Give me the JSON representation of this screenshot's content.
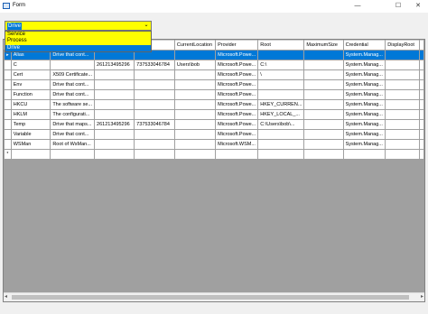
{
  "window": {
    "title": "Form",
    "minimize": "—",
    "maximize": "☐",
    "close": "✕"
  },
  "combo": {
    "value": "Drive",
    "arrow": "⌄"
  },
  "dropdown": {
    "options": [
      {
        "label": "Service",
        "selected": false
      },
      {
        "label": "Process",
        "selected": false
      },
      {
        "label": "Drive",
        "selected": true
      }
    ]
  },
  "grid": {
    "columns": [
      "",
      "",
      "",
      "e",
      "CurrentLocation",
      "Provider",
      "Root",
      "MaximumSize",
      "Credential",
      "DisplayRoot"
    ],
    "rows": [
      [
        "Alias",
        "Drive that cont...",
        "",
        "",
        "",
        "Microsoft.Powe...",
        "",
        "",
        "System.Manag...",
        ""
      ],
      [
        "C",
        "",
        "261213495296",
        "737533046784",
        "Users\\bob",
        "Microsoft.Powe...",
        "C:\\",
        "",
        "System.Manag...",
        ""
      ],
      [
        "Cert",
        "X509 Certificate...",
        "",
        "",
        "",
        "Microsoft.Powe...",
        "\\",
        "",
        "System.Manag...",
        ""
      ],
      [
        "Env",
        "Drive that cont...",
        "",
        "",
        "",
        "Microsoft.Powe...",
        "",
        "",
        "System.Manag...",
        ""
      ],
      [
        "Function",
        "Drive that cont...",
        "",
        "",
        "",
        "Microsoft.Powe...",
        "",
        "",
        "System.Manag...",
        ""
      ],
      [
        "HKCU",
        "The software se...",
        "",
        "",
        "",
        "Microsoft.Powe...",
        "HKEY_CURREN...",
        "",
        "System.Manag...",
        ""
      ],
      [
        "HKLM",
        "The configurati...",
        "",
        "",
        "",
        "Microsoft.Powe...",
        "HKEY_LOCAL_...",
        "",
        "System.Manag...",
        ""
      ],
      [
        "Temp",
        "Drive that maps...",
        "261213495296",
        "737533046784",
        "",
        "Microsoft.Powe...",
        "C:\\Users\\bob\\...",
        "",
        "System.Manag...",
        ""
      ],
      [
        "Variable",
        "Drive that cont...",
        "",
        "",
        "",
        "Microsoft.Powe...",
        "",
        "",
        "System.Manag...",
        ""
      ],
      [
        "WSMan",
        "Root of WsMan...",
        "",
        "",
        "",
        "Microsoft.WSM...",
        "",
        "",
        "System.Manag...",
        ""
      ],
      [
        "",
        "",
        "",
        "",
        "",
        "",
        "",
        "",
        "",
        ""
      ]
    ],
    "current_row_marker": "▸",
    "new_row_marker": "*"
  },
  "scrollbar": {
    "left": "◂",
    "right": "▸"
  }
}
